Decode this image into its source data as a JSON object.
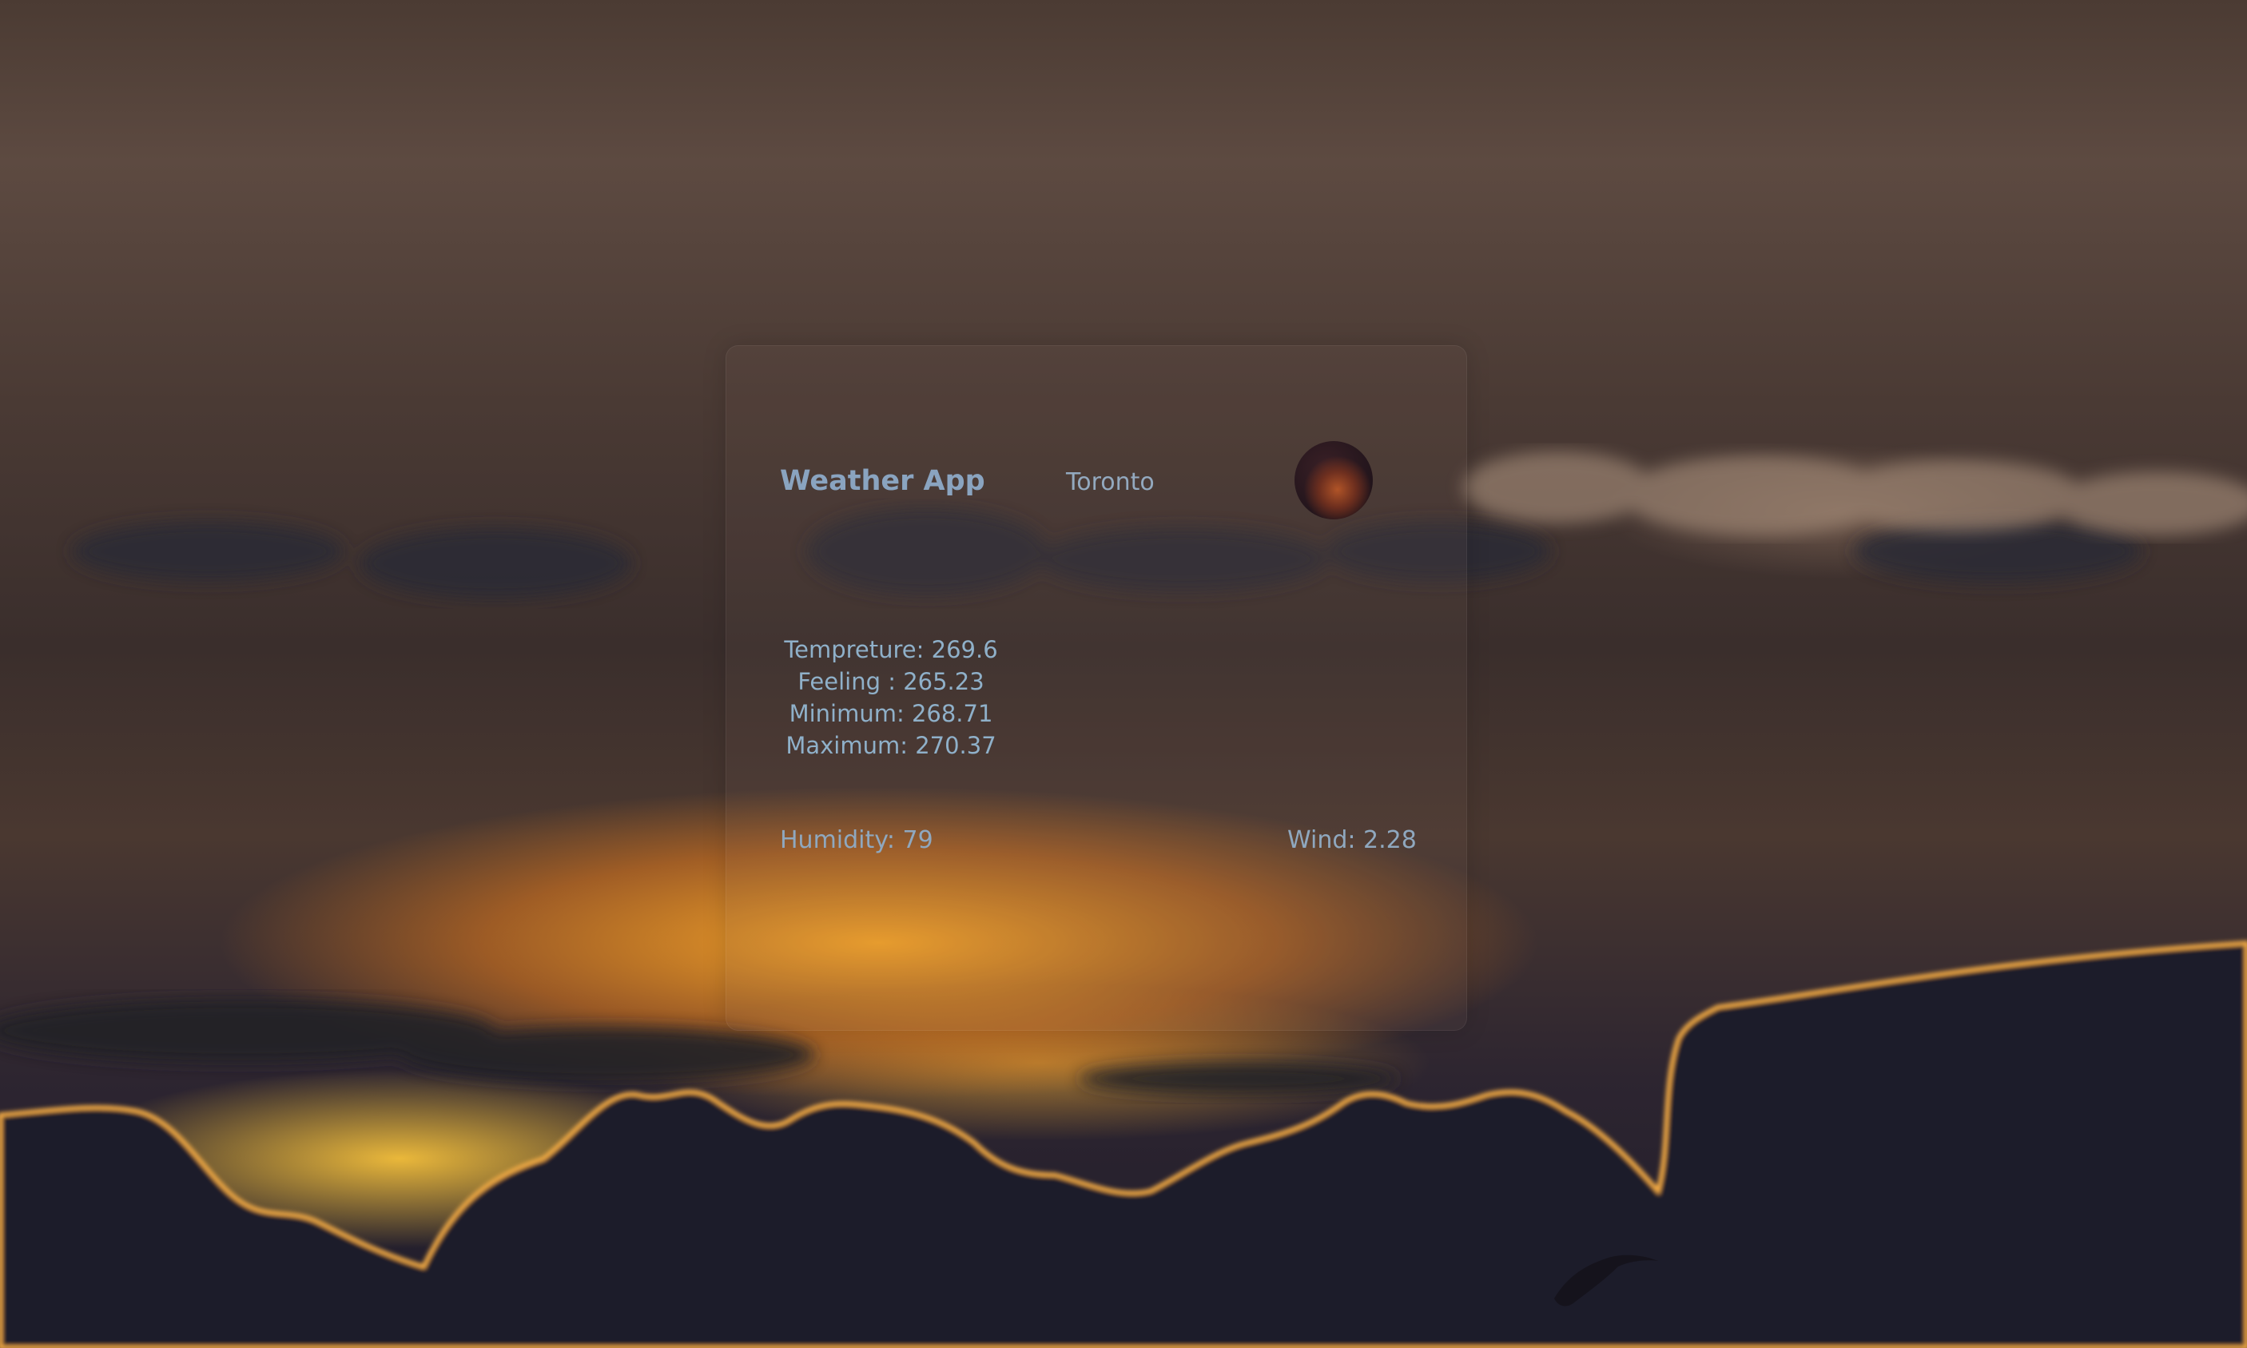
{
  "app": {
    "title": "Weather App",
    "city": "Toronto",
    "weather_icon": "weather-condition-icon"
  },
  "readings": {
    "temperature": "Tempreture: 269.6",
    "feeling": "Feeling : 265.23",
    "minimum": "Minimum: 268.71",
    "maximum": "Maximum: 270.37",
    "humidity": "Humidity: 79",
    "wind": "Wind: 2.28"
  },
  "colors": {
    "text_accent": "#8aa4c0",
    "sky_glow": "#ffaa28"
  }
}
